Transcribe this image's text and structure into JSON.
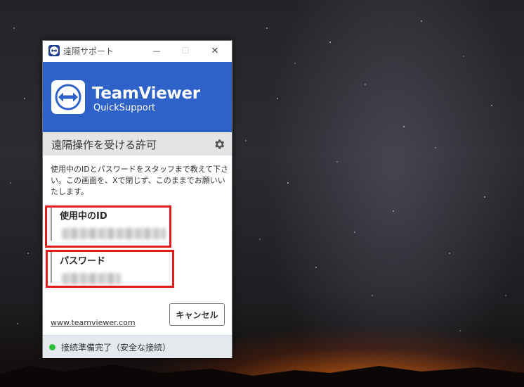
{
  "window": {
    "title": "遠隔サポート",
    "controls": {
      "minimize": "—",
      "maximize": "☐",
      "close": "✕"
    }
  },
  "banner": {
    "brand_name": "TeamViewer",
    "brand_sub": "QuickSupport",
    "logo_icon": "teamviewer-arrows-icon",
    "color": "#2f62c9"
  },
  "section": {
    "title": "遠隔操作を受ける許可",
    "settings_icon": "gear-icon"
  },
  "description": "使用中のIDとパスワードをスタッフまで教えて下さい。この画面を、Xで閉じず、このままでお願いいたします。",
  "fields": {
    "id": {
      "label": "使用中のID"
    },
    "password": {
      "label": "パスワード"
    }
  },
  "footer": {
    "link": "www.teamviewer.com",
    "cancel_label": "キャンセル"
  },
  "status": {
    "text": "接続準備完了（安全な接続）",
    "indicator_color": "#2fbf3a"
  },
  "annotations": {
    "highlight_color": "#e21b1b"
  }
}
